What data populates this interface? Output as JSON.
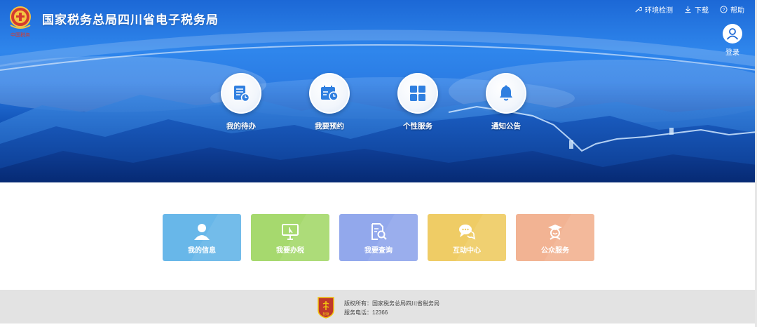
{
  "header": {
    "title": "国家税务总局四川省电子税务局",
    "emblem_text": "中国税务",
    "links": [
      {
        "label": "环境检测",
        "icon": "wrench-icon"
      },
      {
        "label": "下载",
        "icon": "download-icon"
      },
      {
        "label": "帮助",
        "icon": "help-icon"
      }
    ],
    "login_label": "登录"
  },
  "quick_services": [
    {
      "label": "我的待办",
      "icon": "todo-list-icon"
    },
    {
      "label": "我要预约",
      "icon": "calendar-clock-icon"
    },
    {
      "label": "个性服务",
      "icon": "grid-icon"
    },
    {
      "label": "通知公告",
      "icon": "bell-icon"
    }
  ],
  "tiles": [
    {
      "label": "我的信息",
      "icon": "user-icon",
      "color": "#68b7e9"
    },
    {
      "label": "我要办税",
      "icon": "monitor-icon",
      "color": "#a6d96e"
    },
    {
      "label": "我要查询",
      "icon": "search-doc-icon",
      "color": "#92a8ec"
    },
    {
      "label": "互动中心",
      "icon": "chat-icon",
      "color": "#efcc65"
    },
    {
      "label": "公众服务",
      "icon": "public-service-icon",
      "color": "#f2b393"
    }
  ],
  "footer": {
    "badge_text": "税徽",
    "copyright": "版权所有：国家税务总局四川省税务局",
    "phone": "服务电话：12366"
  },
  "colors": {
    "brand_blue": "#1c68d6",
    "footer_bg": "#e3e3e3",
    "icon_blue": "#2f7fe0"
  }
}
